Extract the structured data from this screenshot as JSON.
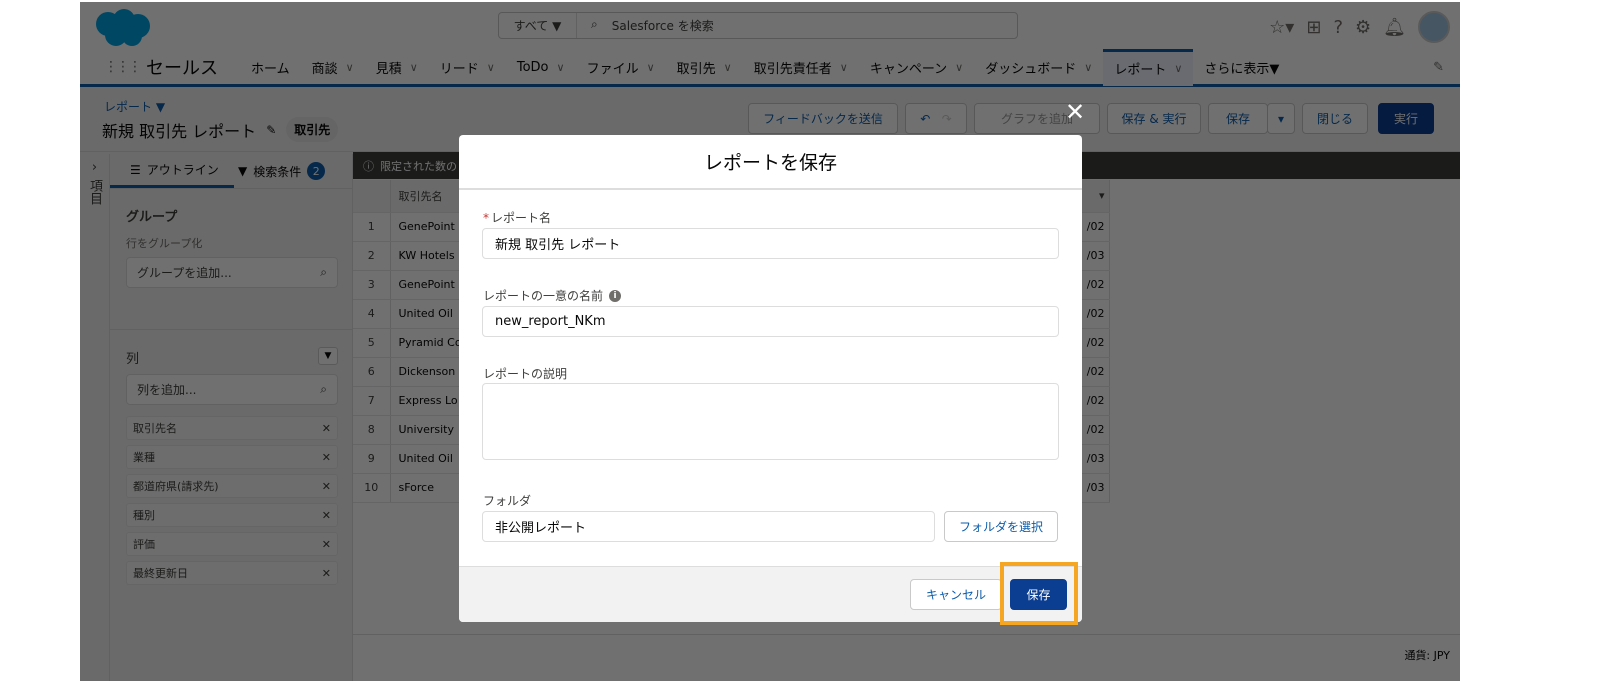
{
  "header": {
    "search_scope": "すべて ▼",
    "search_placeholder": "Salesforce を検索"
  },
  "nav": {
    "app_name": "セールス",
    "items": [
      {
        "label": "ホーム",
        "chevron": false
      },
      {
        "label": "商談",
        "chevron": true
      },
      {
        "label": "見積",
        "chevron": true
      },
      {
        "label": "リード",
        "chevron": true
      },
      {
        "label": "ToDo",
        "chevron": true
      },
      {
        "label": "ファイル",
        "chevron": true
      },
      {
        "label": "取引先",
        "chevron": true
      },
      {
        "label": "取引先責任者",
        "chevron": true
      },
      {
        "label": "キャンペーン",
        "chevron": true
      },
      {
        "label": "ダッシュボード",
        "chevron": true
      },
      {
        "label": "レポート",
        "chevron": true,
        "active": true
      }
    ],
    "more": "さらに表示▼"
  },
  "page": {
    "breadcrumb": "レポート ▼",
    "title": "新規 取引先 レポート",
    "type_badge": "取引先",
    "buttons": {
      "feedback": "フィードバックを送信",
      "add_chart": "グラフを追加",
      "save_run": "保存 & 実行",
      "save": "保存",
      "close": "閉じる",
      "run": "実行"
    }
  },
  "sidebar": {
    "collapsed_label": "項目",
    "tab_outline": "アウトライン",
    "tab_filters": "検索条件",
    "filter_count": "2",
    "group_title": "グループ",
    "group_sub": "行をグループ化",
    "group_placeholder": "グループを追加...",
    "columns_title": "列",
    "columns_placeholder": "列を追加...",
    "columns": [
      "取引先名",
      "業種",
      "都道府県(請求先)",
      "種別",
      "評価",
      "最終更新日"
    ]
  },
  "table": {
    "info": "限定された数の",
    "header": "取引先名",
    "rows": [
      {
        "n": "1",
        "name": "GenePoint",
        "date": "/02"
      },
      {
        "n": "2",
        "name": "KW Hotels",
        "date": "/03"
      },
      {
        "n": "3",
        "name": "GenePoint",
        "date": "/02"
      },
      {
        "n": "4",
        "name": "United Oil",
        "date": "/02"
      },
      {
        "n": "5",
        "name": "Pyramid Co",
        "date": "/02"
      },
      {
        "n": "6",
        "name": "Dickenson",
        "date": "/02"
      },
      {
        "n": "7",
        "name": "Express Lo",
        "date": "/02"
      },
      {
        "n": "8",
        "name": "University",
        "date": "/02"
      },
      {
        "n": "9",
        "name": "United Oil",
        "date": "/03"
      },
      {
        "n": "10",
        "name": "sForce",
        "date": "/03"
      }
    ]
  },
  "footer": {
    "currency": "通貨: JPY"
  },
  "modal": {
    "title": "レポートを保存",
    "name_label": "レポート名",
    "name_value": "新規 取引先 レポート",
    "unique_label": "レポートの一意の名前",
    "unique_value": "new_report_NKm",
    "desc_label": "レポートの説明",
    "desc_value": "",
    "folder_label": "フォルダ",
    "folder_value": "非公開レポート",
    "folder_button": "フォルダを選択",
    "cancel": "キャンセル",
    "save": "保存"
  },
  "colors": {
    "brand": "#0b3d91",
    "accent": "#0b5cab",
    "highlight": "#f5a623",
    "required": "#c23934"
  }
}
